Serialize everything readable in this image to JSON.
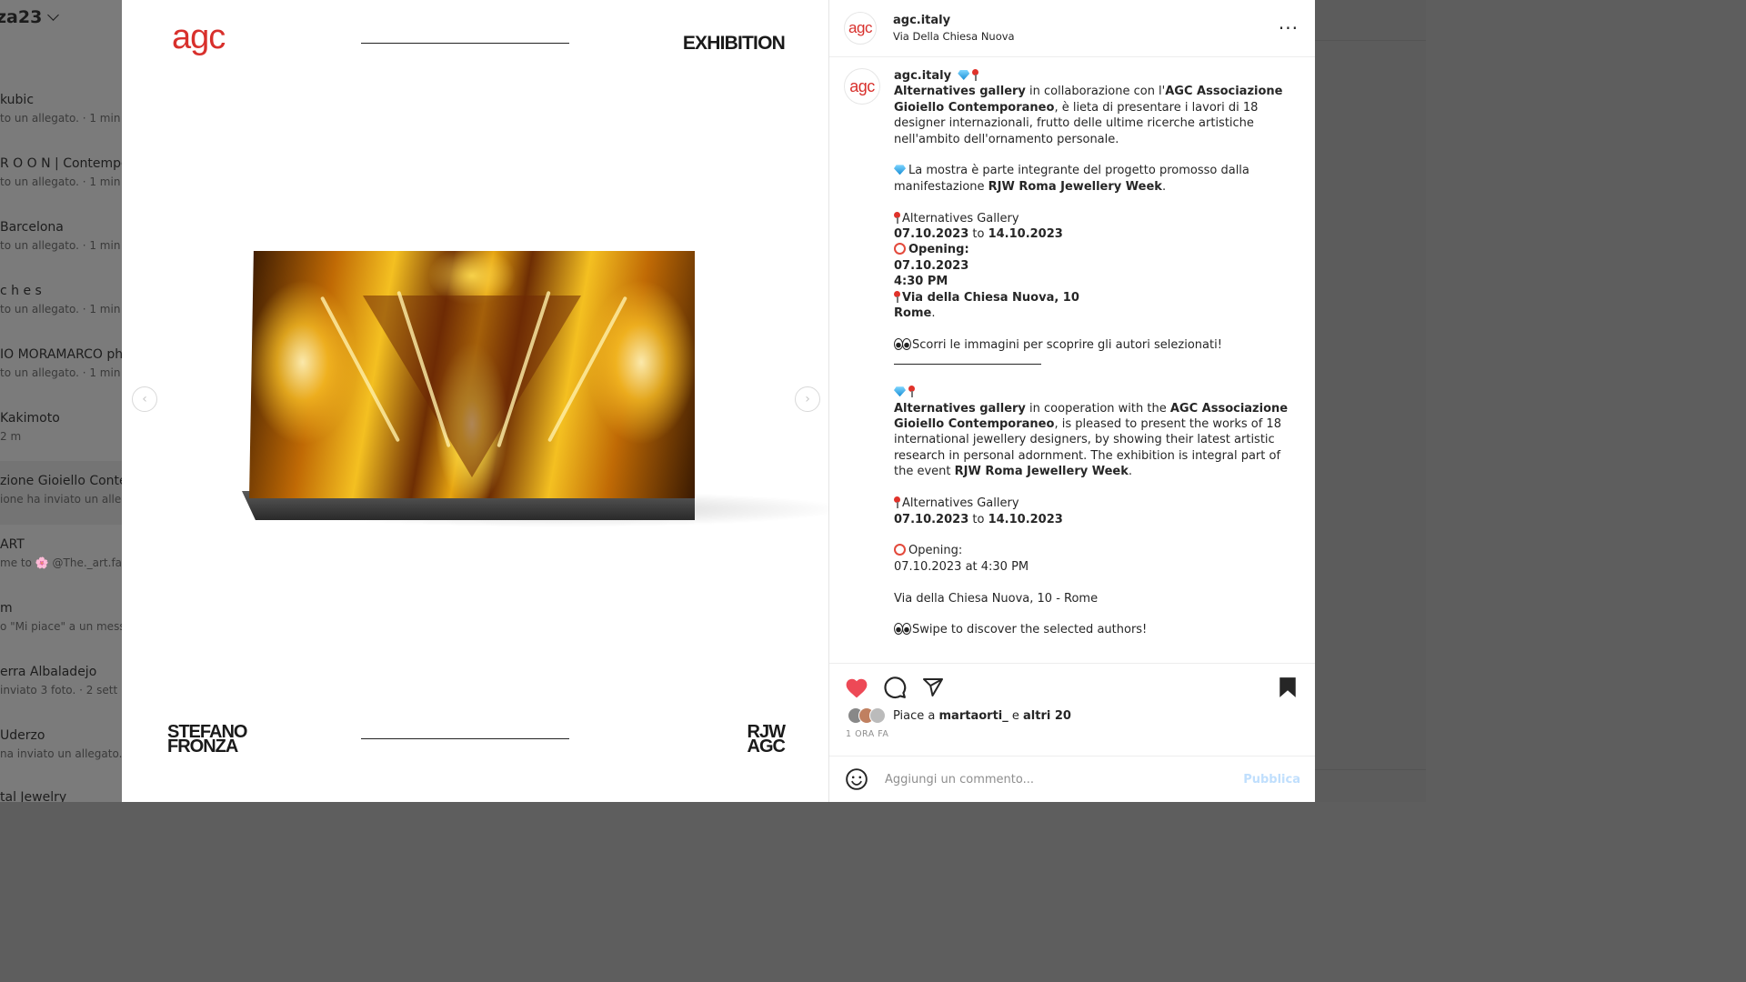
{
  "background": {
    "account_name": "za23",
    "dm_items": [
      {
        "name": "kubic",
        "sub": "to un allegato. · 1 min"
      },
      {
        "name": "R O O N | Contempo",
        "sub": "to un allegato. · 1 min"
      },
      {
        "name": "Barcelona",
        "sub": "to un allegato. · 1 min"
      },
      {
        "name": "c h e s",
        "sub": "to un allegato. · 1 min"
      },
      {
        "name": "IO MORAMARCO ph",
        "sub": "to un allegato. · 1 min"
      },
      {
        "name": "Kakimoto",
        "sub": "2 m"
      },
      {
        "name": "zione Gioiello Conte",
        "sub": "ione ha inviato un allega"
      },
      {
        "name": "ART",
        "sub": "me to 🌸 @The._art.fac"
      },
      {
        "name": "m",
        "sub": "o \"Mi piace\" a un messa"
      },
      {
        "name": "erra Albaladejo",
        "sub": "inviato 3 foto. · 2 sett"
      },
      {
        "name": "Uderzo",
        "sub": "na inviato un allegato. ·"
      },
      {
        "name": "tal Jewelry",
        "sub": ""
      }
    ]
  },
  "media": {
    "logo": "agc",
    "header_right": "EXHIBITION",
    "artist_line1": "STEFANO",
    "artist_line2": "FRONZA",
    "footer_line1": "RJW",
    "footer_line2": "AGC",
    "prev_icon": "‹",
    "next_icon": "›"
  },
  "post": {
    "username": "agc.italy",
    "location": "Via Della Chiesa Nuova",
    "avatar_text": "agc",
    "more_icon": "···",
    "caption": {
      "username": "agc.italy",
      "it_p1_b1": "Alternatives gallery",
      "it_p1_t1": " in collaborazione con l'",
      "it_p1_b2": "AGC Associazione Gioiello Contemporaneo",
      "it_p1_t2": ", è lieta di presentare i lavori di 18 designer internazionali, frutto delle ultime ricerche artistiche nell'ambito dell'ornamento personale.",
      "it_p2_t1": "La mostra è parte integrante del progetto promosso dalla manifestazione ",
      "it_p2_b1": "RJW Roma Jewellery Week",
      "it_p2_t2": ".",
      "it_gallery": "Alternatives Gallery",
      "it_dates_b1": "07.10.2023",
      "it_dates_t": " to ",
      "it_dates_b2": "14.10.2023",
      "it_opening": "Opening:",
      "it_open_date": "07.10.2023",
      "it_open_time": "4:30 PM",
      "it_address": "Via della Chiesa Nuova, 10",
      "it_city": "Rome",
      "it_scroll": "Scorri le immagini per scoprire gli autori selezionati!",
      "en_p1_b1": "Alternatives gallery",
      "en_p1_t1": " in cooperation with the ",
      "en_p1_b2": "AGC Associazione Gioiello Contemporaneo",
      "en_p1_t2": ", is pleased to present the works of 18 international jewellery designers, by showing their latest artistic research in personal adornment. The exhibition is integral part of the event ",
      "en_p1_b3": "RJW Roma Jewellery Week",
      "en_p1_t3": ".",
      "en_gallery": "Alternatives Gallery",
      "en_dates_b1": "07.10.2023",
      "en_dates_t": " to ",
      "en_dates_b2": "14.10.2023",
      "en_opening": "Opening:",
      "en_open_datetime": "07.10.2023 at 4:30 PM",
      "en_address": "Via della Chiesa Nuova, 10 - Rome",
      "en_swipe": "Swipe to discover the selected authors!"
    },
    "actions": {
      "like_icon": "heart-filled",
      "like_color": "#ed4956",
      "comment_icon": "comment",
      "share_icon": "paper-plane",
      "save_icon": "bookmark-filled"
    },
    "likes_prefix": "Piace a ",
    "likes_user": "martaorti_",
    "likes_mid": " e ",
    "likes_others": "altri 20",
    "time_ago": "1 ORA FA",
    "comment_placeholder": "Aggiungi un commento...",
    "publish_label": "Pubblica"
  }
}
